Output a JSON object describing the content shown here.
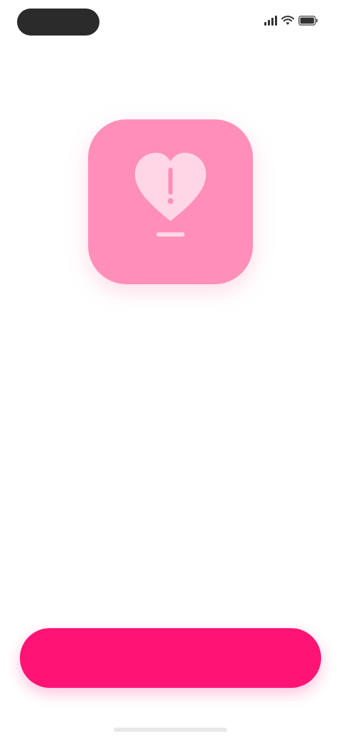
{
  "status_bar": {
    "time": "",
    "signal_icon": "cellular-signal-icon",
    "wifi_icon": "wifi-icon",
    "battery_icon": "battery-icon"
  },
  "app_icon": {
    "icon": "heart-icon",
    "color": "#ff8fb9"
  },
  "welcome_label": "",
  "app_title": "",
  "description": "",
  "continue_button": {
    "label": "",
    "color": "#ff1476"
  },
  "colors": {
    "accent": "#f0479a",
    "button": "#ff1476",
    "icon_background": "#ff8fb9"
  }
}
